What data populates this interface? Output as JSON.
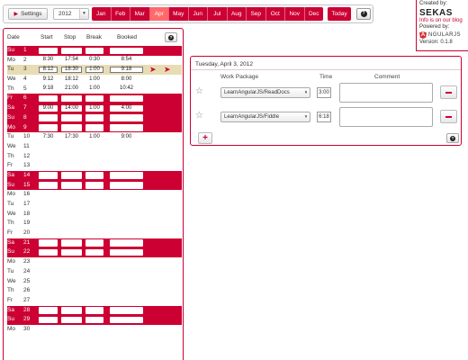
{
  "toolbar": {
    "settings_label": "Settings",
    "year": "2012",
    "months": [
      "Jan",
      "Feb",
      "Mar",
      "Apr",
      "May",
      "Jun",
      "Jul",
      "Aug",
      "Sep",
      "Oct",
      "Nov",
      "Dec"
    ],
    "active_month": "Apr",
    "today_label": "Today",
    "help_label": "?"
  },
  "credits": {
    "created_by": "Created by:",
    "brand": "SEKAS",
    "blog_link": "Info is on our blog",
    "powered_by": "Powered by:",
    "framework_logo_letter": "A",
    "framework_name": "NGULARJS",
    "version": "Version: 0.1.8"
  },
  "calendar": {
    "headers": {
      "date": "Date",
      "start": "Start",
      "stop": "Stop",
      "break": "Break",
      "booked": "Booked"
    },
    "help_label": "?",
    "rows": [
      {
        "dow": "Su",
        "day": "1",
        "weekend": true,
        "boxed": false,
        "start": "",
        "stop": "",
        "break": "",
        "booked": ""
      },
      {
        "dow": "Mo",
        "day": "2",
        "weekend": false,
        "boxed": false,
        "start": "8:30",
        "stop": "17:54",
        "break": "0:30",
        "booked": "8:54"
      },
      {
        "dow": "Tu",
        "day": "3",
        "weekend": false,
        "boxed": true,
        "selected": true,
        "start": "8:12",
        "stop": "18:30",
        "break": "1:00",
        "booked": "9:18"
      },
      {
        "dow": "We",
        "day": "4",
        "weekend": false,
        "boxed": false,
        "start": "9:12",
        "stop": "18:12",
        "break": "1:00",
        "booked": "8:00"
      },
      {
        "dow": "Th",
        "day": "5",
        "weekend": false,
        "boxed": false,
        "start": "9:18",
        "stop": "21:00",
        "break": "1:00",
        "booked": "10:42"
      },
      {
        "dow": "Fr",
        "day": "6",
        "weekend": true,
        "boxed": false,
        "start": "",
        "stop": "",
        "break": "",
        "booked": ""
      },
      {
        "dow": "Sa",
        "day": "7",
        "weekend": true,
        "boxed": false,
        "start": "9:00",
        "stop": "14:00",
        "break": "1:00",
        "booked": "4:00"
      },
      {
        "dow": "Su",
        "day": "8",
        "weekend": true,
        "boxed": false,
        "start": "",
        "stop": "",
        "break": "",
        "booked": ""
      },
      {
        "dow": "Mo",
        "day": "9",
        "weekend": true,
        "boxed": false,
        "start": "",
        "stop": "",
        "break": "",
        "booked": ""
      },
      {
        "dow": "Tu",
        "day": "10",
        "weekend": false,
        "boxed": false,
        "start": "7:30",
        "stop": "17:30",
        "break": "1:00",
        "booked": "9:00"
      },
      {
        "dow": "We",
        "day": "11",
        "weekend": false,
        "boxed": false,
        "start": "",
        "stop": "",
        "break": "",
        "booked": ""
      },
      {
        "dow": "Th",
        "day": "12",
        "weekend": false,
        "boxed": false,
        "start": "",
        "stop": "",
        "break": "",
        "booked": ""
      },
      {
        "dow": "Fr",
        "day": "13",
        "weekend": false,
        "boxed": false,
        "start": "",
        "stop": "",
        "break": "",
        "booked": ""
      },
      {
        "dow": "Sa",
        "day": "14",
        "weekend": true,
        "boxed": false,
        "start": "",
        "stop": "",
        "break": "",
        "booked": ""
      },
      {
        "dow": "Su",
        "day": "15",
        "weekend": true,
        "boxed": false,
        "start": "",
        "stop": "",
        "break": "",
        "booked": ""
      },
      {
        "dow": "Mo",
        "day": "16",
        "weekend": false,
        "boxed": false,
        "start": "",
        "stop": "",
        "break": "",
        "booked": ""
      },
      {
        "dow": "Tu",
        "day": "17",
        "weekend": false,
        "boxed": false,
        "start": "",
        "stop": "",
        "break": "",
        "booked": ""
      },
      {
        "dow": "We",
        "day": "18",
        "weekend": false,
        "boxed": false,
        "start": "",
        "stop": "",
        "break": "",
        "booked": ""
      },
      {
        "dow": "Th",
        "day": "19",
        "weekend": false,
        "boxed": false,
        "start": "",
        "stop": "",
        "break": "",
        "booked": ""
      },
      {
        "dow": "Fr",
        "day": "20",
        "weekend": false,
        "boxed": false,
        "start": "",
        "stop": "",
        "break": "",
        "booked": ""
      },
      {
        "dow": "Sa",
        "day": "21",
        "weekend": true,
        "boxed": false,
        "start": "",
        "stop": "",
        "break": "",
        "booked": ""
      },
      {
        "dow": "Su",
        "day": "22",
        "weekend": true,
        "boxed": false,
        "start": "",
        "stop": "",
        "break": "",
        "booked": ""
      },
      {
        "dow": "Mo",
        "day": "23",
        "weekend": false,
        "boxed": false,
        "start": "",
        "stop": "",
        "break": "",
        "booked": ""
      },
      {
        "dow": "Tu",
        "day": "24",
        "weekend": false,
        "boxed": false,
        "start": "",
        "stop": "",
        "break": "",
        "booked": ""
      },
      {
        "dow": "We",
        "day": "25",
        "weekend": false,
        "boxed": false,
        "start": "",
        "stop": "",
        "break": "",
        "booked": ""
      },
      {
        "dow": "Th",
        "day": "26",
        "weekend": false,
        "boxed": false,
        "start": "",
        "stop": "",
        "break": "",
        "booked": ""
      },
      {
        "dow": "Fr",
        "day": "27",
        "weekend": false,
        "boxed": false,
        "start": "",
        "stop": "",
        "break": "",
        "booked": ""
      },
      {
        "dow": "Sa",
        "day": "28",
        "weekend": true,
        "boxed": false,
        "start": "",
        "stop": "",
        "break": "",
        "booked": ""
      },
      {
        "dow": "Su",
        "day": "29",
        "weekend": true,
        "boxed": false,
        "start": "",
        "stop": "",
        "break": "",
        "booked": ""
      },
      {
        "dow": "Mo",
        "day": "30",
        "weekend": false,
        "boxed": false,
        "start": "",
        "stop": "",
        "break": "",
        "booked": ""
      }
    ],
    "selected_marker": "➤ ➤"
  },
  "detail": {
    "date": "Tuesday, April 3, 2012",
    "col_work_package": "Work Package",
    "col_time": "Time",
    "col_comment": "Comment",
    "entries": [
      {
        "work_package": "LearnAngularJS/ReadDocs",
        "time": "3:00",
        "comment": ""
      },
      {
        "work_package": "LearnAngularJS/Fiddle",
        "time": "6:18",
        "comment": ""
      }
    ],
    "add_label": "+",
    "help_label": "?"
  },
  "colors": {
    "accent": "#cc0033",
    "active_month": "#ff6a6a",
    "selected_row": "#e8dcb5"
  }
}
